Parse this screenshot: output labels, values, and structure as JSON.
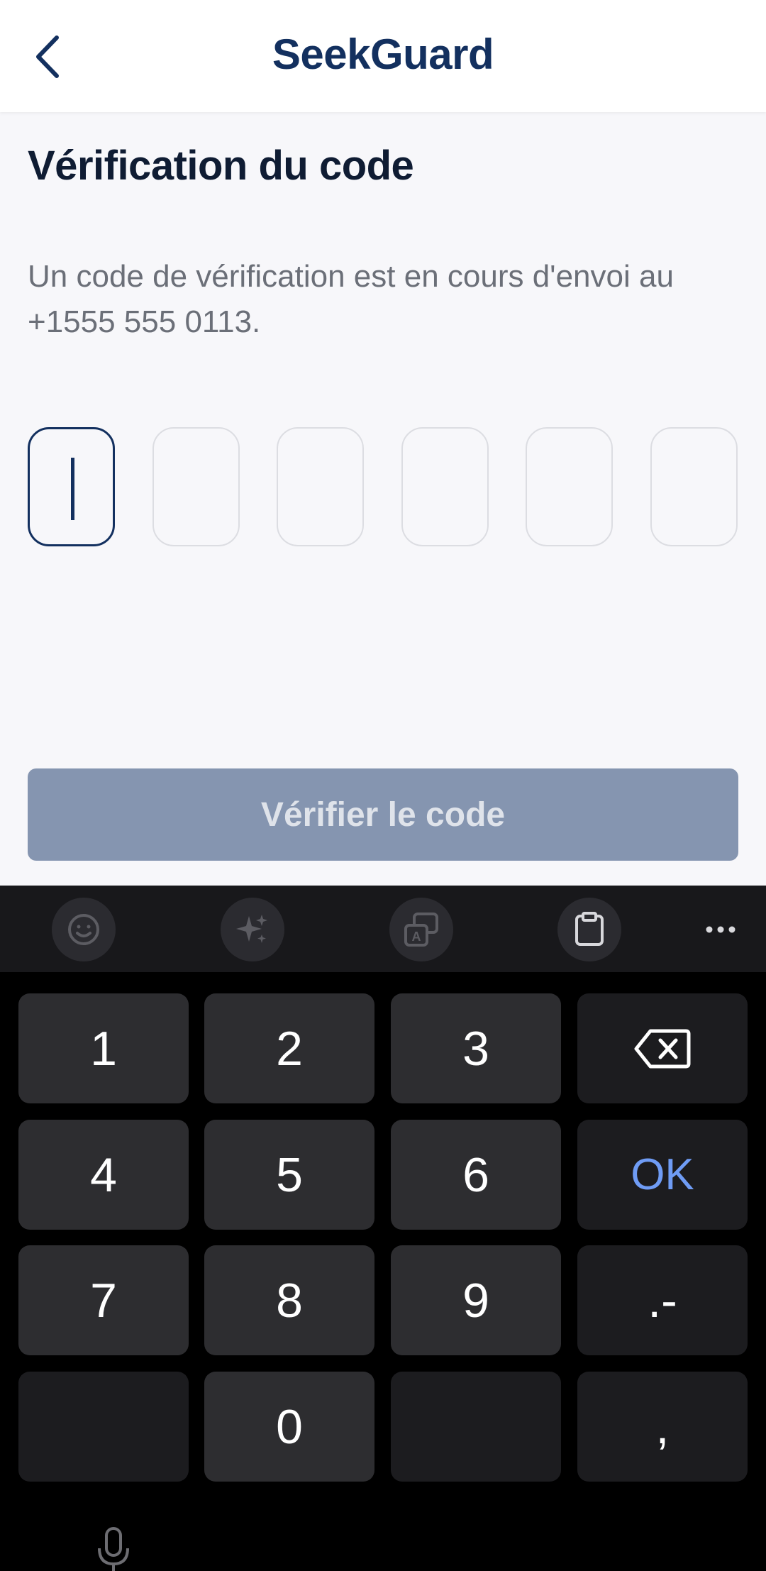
{
  "header": {
    "title": "SeekGuard",
    "back_icon": "chevron-left-icon"
  },
  "page": {
    "heading": "Vérification du code",
    "description": "Un code de vérification est en cours d'envoi au +1555 555 0113."
  },
  "code_input": {
    "length": 6,
    "active_index": 0,
    "digits": [
      "",
      "",
      "",
      "",
      "",
      ""
    ]
  },
  "verify_button": {
    "label": "Vérifier le code",
    "enabled": false
  },
  "keyboard": {
    "toolbar": [
      "emoji-icon",
      "sparkle-icon",
      "translate-icon",
      "clipboard-icon",
      "more-icon"
    ],
    "rows": [
      [
        "1",
        "2",
        "3",
        "backspace"
      ],
      [
        "4",
        "5",
        "6",
        "OK"
      ],
      [
        "7",
        "8",
        "9",
        ".-"
      ],
      [
        "",
        "0",
        "",
        ","
      ]
    ],
    "k1": "1",
    "k2": "2",
    "k3": "3",
    "k4": "4",
    "k5": "5",
    "k6": "6",
    "ok": "OK",
    "k7": "7",
    "k8": "8",
    "k9": "9",
    "dotdash": ".-",
    "k0": "0",
    "comma": ","
  },
  "colors": {
    "brand": "#13305f",
    "button_disabled": "#8595b0",
    "ok_key": "#6f9cf5"
  }
}
